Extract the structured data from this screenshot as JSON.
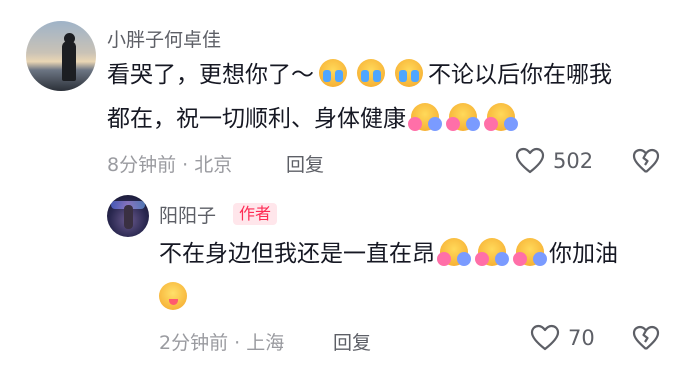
{
  "comment1": {
    "username": "小胖子何卓佳",
    "text_line1_before": "看哭了，更想你了～",
    "text_line1_after": "不论以后你在哪我",
    "text_line2": "都在，祝一切顺利、身体健康",
    "meta": "8分钟前 · 北京",
    "reply_label": "回复",
    "like_count": "502",
    "emoji_cry": "loudly-crying-face",
    "emoji_hug": "hugging-face"
  },
  "comment2": {
    "username": "阳阳子",
    "author_badge": "作者",
    "text_before": "不在身边但我还是一直在昂",
    "text_after": "你加油",
    "meta": "2分钟前 · 上海",
    "reply_label": "回复",
    "like_count": "70",
    "emoji_yum": "face-savoring-food"
  },
  "colors": {
    "author_badge": "#fe2c55",
    "meta": "#9a9ba0",
    "text": "#161823"
  }
}
